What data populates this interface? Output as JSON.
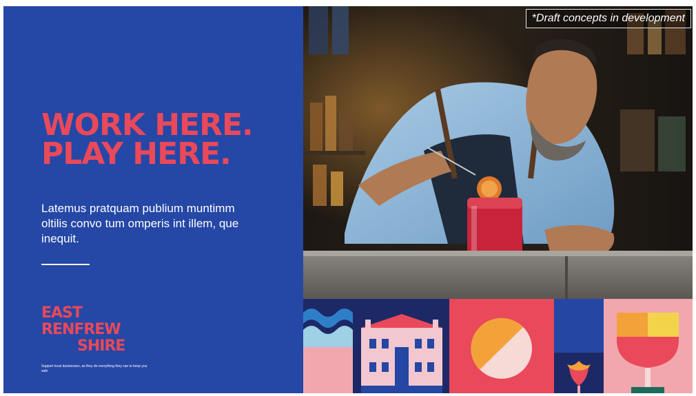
{
  "headline": {
    "line1": "WORK HERE.",
    "line2": "PLAY HERE."
  },
  "body_copy": "Latemus pratquam publium muntimm oltilis convo tum omperis int illem, que inequit.",
  "logo": {
    "line1": "EAST",
    "line2": "RENFREW",
    "line3": "SHIRE"
  },
  "tagline": "Support local businesses, as they do everything they can to keep you safe",
  "draft_note": "*Draft concepts in development",
  "colors": {
    "blue": "#2547a6",
    "coral": "#e9495a",
    "pink": "#f2a7ae",
    "navy": "#1c2966",
    "orange": "#f3a23a",
    "yellow": "#f3d34a"
  },
  "icons": [
    "bartender-photo",
    "wave-pattern",
    "historic-house-icon",
    "citrus-slice-icon",
    "tulip-icon",
    "cocktail-glass-icon"
  ]
}
